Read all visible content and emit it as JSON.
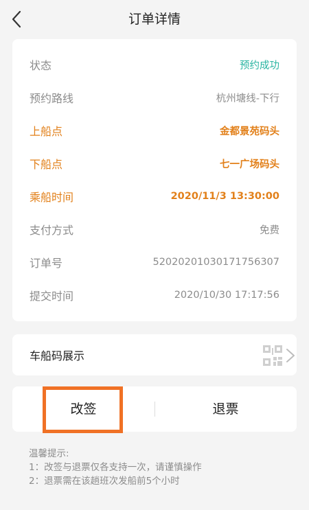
{
  "header": {
    "title": "订单详情"
  },
  "details": {
    "rows": [
      {
        "label": "状态",
        "value": "预约成功"
      },
      {
        "label": "预约路线",
        "value": "杭州塘线-下行"
      },
      {
        "label": "上船点",
        "value": "金都景苑码头"
      },
      {
        "label": "下船点",
        "value": "七一广场码头"
      },
      {
        "label": "乘船时间",
        "value": "2020/11/3 13:30:00"
      },
      {
        "label": "支付方式",
        "value": "免费"
      },
      {
        "label": "订单号",
        "value": "52020201030171756307"
      },
      {
        "label": "提交时间",
        "value": "2020/10/30 17:17:56"
      }
    ]
  },
  "qr": {
    "label": "车船码展示"
  },
  "actions": {
    "change": "改签",
    "refund": "退票"
  },
  "tips": {
    "title": "温馨提示:",
    "lines": [
      "1：改签与退票仅各支持一次，请谨慎操作",
      "2：退票需在该趟班次发船前5个小时"
    ]
  },
  "colors": {
    "accent": "#e2801a",
    "success": "#2bb5a2",
    "highlight": "#f07125"
  }
}
